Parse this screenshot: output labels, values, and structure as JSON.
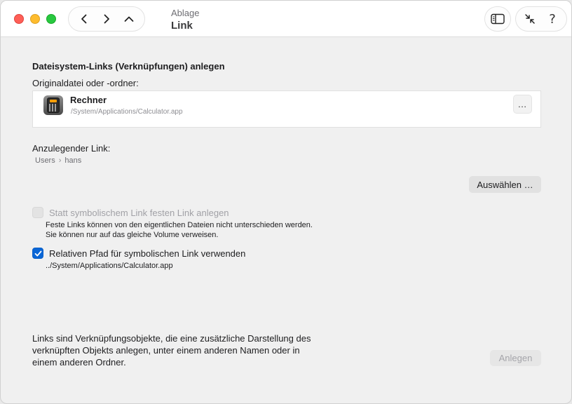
{
  "window": {
    "subtitle": "Ablage",
    "title": "Link"
  },
  "toolbar": {
    "back_icon": "chevron-left-icon",
    "forward_icon": "chevron-right-icon",
    "up_icon": "chevron-up-icon",
    "sidebar_icon": "sidebar-icon",
    "collapse_icon": "arrows-in-icon",
    "help_label": "?"
  },
  "main": {
    "section_title": "Dateisystem-Links (Verknüpfungen) anlegen",
    "original_label": "Originaldatei oder -ordner:",
    "original_file": {
      "name": "Rechner",
      "path": "/System/Applications/Calculator.app",
      "more_label": "…"
    },
    "target_label": "Anzulegender Link:",
    "breadcrumb": [
      "Users",
      "hans"
    ],
    "choose_button": "Auswählen …",
    "hard_link": {
      "label": "Statt symbolischem Link festen Link anlegen",
      "checked": false,
      "enabled": false,
      "note": "Feste Links können von den eigentlichen Dateien nicht unterschieden werden. Sie können nur auf das gleiche Volume verweisen."
    },
    "relative_path": {
      "label": "Relativen Pfad für symbolischen Link verwenden",
      "checked": true,
      "enabled": true,
      "note": "../System/Applications/Calculator.app"
    },
    "info_text": "Links sind Verknüpfungsobjekte, die eine zusätzliche Darstellung des verknüpften Objekts anlegen, unter einem anderen Namen oder in einem anderen Ordner.",
    "create_button": "Anlegen"
  },
  "colors": {
    "accent": "#0a66d6",
    "traffic_close": "#fe5f57",
    "traffic_min": "#febc2e",
    "traffic_max": "#28c840"
  }
}
